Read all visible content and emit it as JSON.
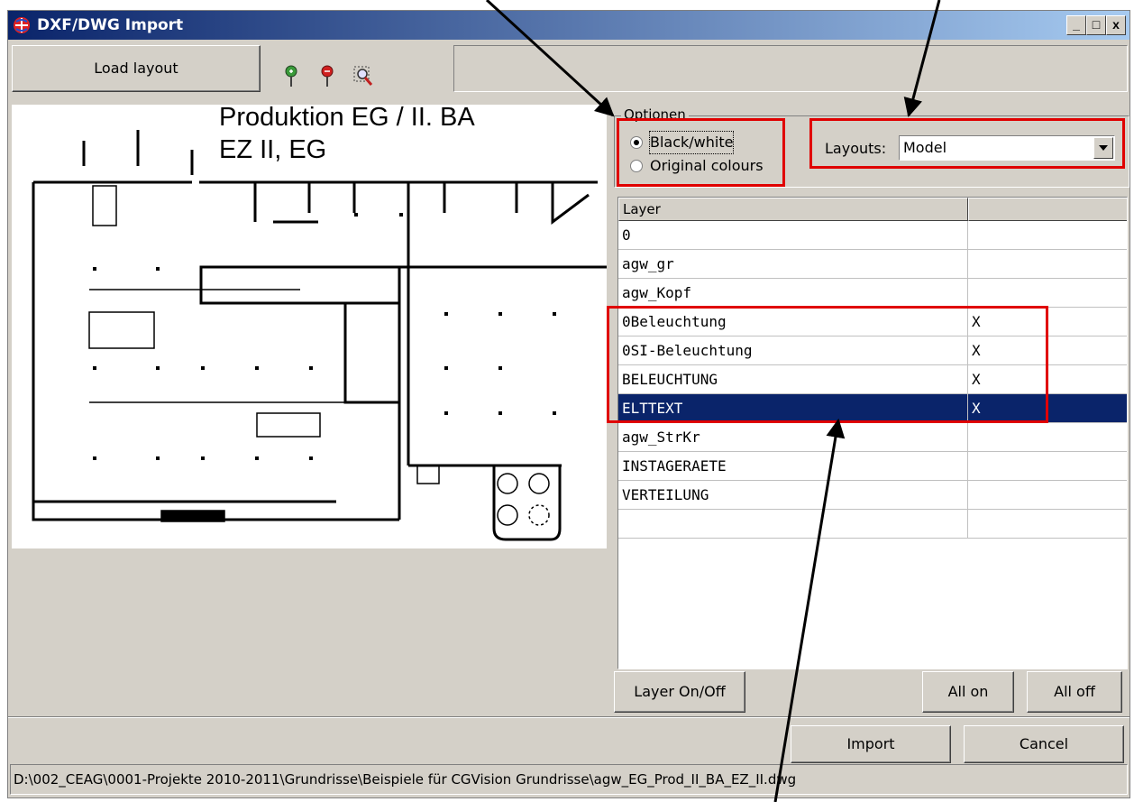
{
  "window": {
    "title": "DXF/DWG Import",
    "controls": [
      "_",
      "□",
      "x"
    ]
  },
  "toolbar": {
    "load_layout_label": "Load layout",
    "icons": [
      "zoom-in-pin-icon",
      "zoom-out-pin-icon",
      "zoom-fit-icon"
    ]
  },
  "preview": {
    "title": "Produktion EG / II. BA",
    "subtitle": "EZ II,  EG"
  },
  "options": {
    "group_label": "Optionen",
    "radio_bw": "Black/white",
    "radio_orig": "Original colours",
    "selected": "Black/white",
    "layouts_label": "Layouts:",
    "layouts_value": "Model"
  },
  "layers": {
    "header": "Layer",
    "rows": [
      {
        "name": "0",
        "state": ""
      },
      {
        "name": "agw_gr",
        "state": ""
      },
      {
        "name": "agw_Kopf",
        "state": ""
      },
      {
        "name": "0Beleuchtung",
        "state": "X"
      },
      {
        "name": "0SI-Beleuchtung",
        "state": "X"
      },
      {
        "name": "BELEUCHTUNG",
        "state": "X"
      },
      {
        "name": "ELTTEXT",
        "state": "X"
      },
      {
        "name": "agw_StrKr",
        "state": ""
      },
      {
        "name": "INSTAGERAETE",
        "state": ""
      },
      {
        "name": "VERTEILUNG",
        "state": ""
      },
      {
        "name": "",
        "state": ""
      }
    ],
    "selected_row": "ELTTEXT"
  },
  "buttons": {
    "layer_onoff": "Layer On/Off",
    "all_on": "All on",
    "all_off": "All off",
    "import": "Import",
    "cancel": "Cancel"
  },
  "status": {
    "path": "D:\\002_CEAG\\0001-Projekte 2010-2011\\Grundrisse\\Beispiele für CGVision Grundrisse\\agw_EG_Prod_II_BA_EZ_II.dwg"
  },
  "colors": {
    "title_bar_start": "#0a246a",
    "title_bar_end": "#a6caf0",
    "selection": "#0a246a",
    "annotation_red": "#e00000",
    "face": "#d4d0c8"
  }
}
